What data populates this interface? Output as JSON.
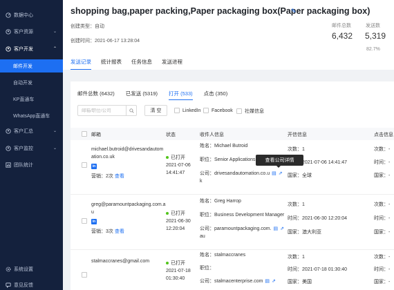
{
  "sidebar": {
    "items": [
      {
        "label": "数据中心",
        "icon": "dashboard-icon"
      },
      {
        "label": "客户资源",
        "icon": "user-icon"
      },
      {
        "label": "客户开发",
        "icon": "user-icon"
      },
      {
        "label": "客户汇总",
        "icon": "user-icon"
      },
      {
        "label": "客户监控",
        "icon": "user-icon"
      },
      {
        "label": "团队统计",
        "icon": "chart-icon"
      }
    ],
    "sub_items": [
      "邮件开发",
      "自动开发",
      "KP直通车",
      "WhatsApp直通车"
    ],
    "bottom": [
      "系统设置",
      "意见反馈"
    ]
  },
  "header": {
    "title": "shopping bag,paper packing,Paper packaging box(Paper packaging box)",
    "create_type": "创建类型：自动",
    "create_time": "创建时间：2021-06-17 13:28:04",
    "stats": {
      "total_label": "邮件总数",
      "total_value": "6,432",
      "sent_label": "发送数",
      "sent_value": "5,319",
      "sent_pct": "82.7%"
    }
  },
  "tabs": [
    "发送记录",
    "统计报表",
    "任务信息",
    "发送进程"
  ],
  "subtabs": [
    "邮件总数 (6432)",
    "已发送 (5319)",
    "打开 (533)",
    "点击 (350)"
  ],
  "search": {
    "placeholder": "邮箱/职位/公司"
  },
  "clear_label": "清 空",
  "filters": [
    "LinkedIn",
    "Facebook",
    "社媒信息"
  ],
  "columns": [
    "邮箱",
    "状态",
    "收件人信息",
    "开信信息",
    "点击信息"
  ],
  "li_text": "in",
  "tooltip": "查看公司详情",
  "rows": [
    {
      "email": "michael.butroid@drivesandautom",
      "email2": "ation.co.uk",
      "marketing": "营销：2次",
      "view": "查看",
      "status": "已打开",
      "date": "2021-07-06",
      "time": "14:41:47",
      "name": "姓名：Michael Butroid",
      "position": "职位：Senior Applications E",
      "company": "公司：drivesandautomation.co.u",
      "company2": "k",
      "open_count": "次数：1",
      "open_time": "时间：2021-07-06 14:41:47",
      "open_country": "国家：全球",
      "click_count": "次数：-",
      "click_time": "时间：-",
      "click_country": "国家：-"
    },
    {
      "email": "greg@paramountpackaging.com.a",
      "email2": "u",
      "marketing": "营销：3次",
      "view": "查看",
      "status": "已打开",
      "date": "2021-06-30",
      "time": "12:20:04",
      "name": "姓名：Greg Harrop",
      "position": "职位：Business Development Manager",
      "company": "公司：paramountpackaging.com.",
      "company2": "au",
      "open_count": "次数：1",
      "open_time": "时间：2021-06-30 12:20:04",
      "open_country": "国家：澳大利亚",
      "click_count": "次数：-",
      "click_time": "时间：-",
      "click_country": "国家：-"
    },
    {
      "email": "stalmaccranes@gmail.com",
      "email2": "",
      "marketing": "",
      "view": "",
      "status": "已打开",
      "date": "2021-07-18",
      "time": "01:30:40",
      "name": "姓名：stalmaccranes",
      "position": "职位：",
      "company": "公司：stalmacenterprise.com",
      "company2": "",
      "open_count": "次数：1",
      "open_time": "时间：2021-07-18 01:30:40",
      "open_country": "国家：美国",
      "click_count": "次数：-",
      "click_time": "时间：-",
      "click_country": "国家：-"
    }
  ]
}
